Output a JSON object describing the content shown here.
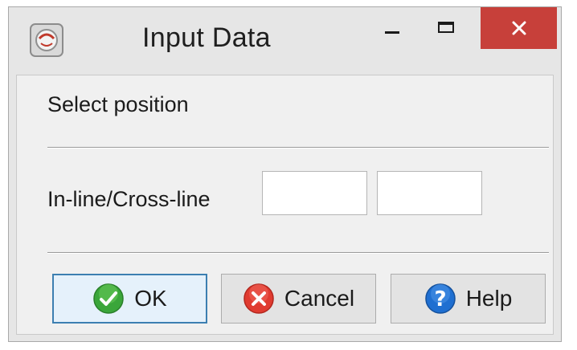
{
  "window": {
    "title": "Input Data",
    "icon": "app-icon",
    "controls": {
      "minimize": "minimize-icon",
      "maximize": "maximize-icon",
      "close": "close-icon"
    }
  },
  "content": {
    "heading": "Select position",
    "field_label": "In-line/Cross-line",
    "inline_value": "",
    "crossline_value": ""
  },
  "buttons": {
    "ok": {
      "label": "OK",
      "icon": "check-icon",
      "color": "#3aa63a"
    },
    "cancel": {
      "label": "Cancel",
      "icon": "cancel-icon",
      "color": "#e03b30"
    },
    "help": {
      "label": "Help",
      "icon": "help-icon",
      "color": "#1f6fd1"
    }
  },
  "colors": {
    "close_button": "#c7403a",
    "ok_focus_border": "#3c7fb1"
  }
}
